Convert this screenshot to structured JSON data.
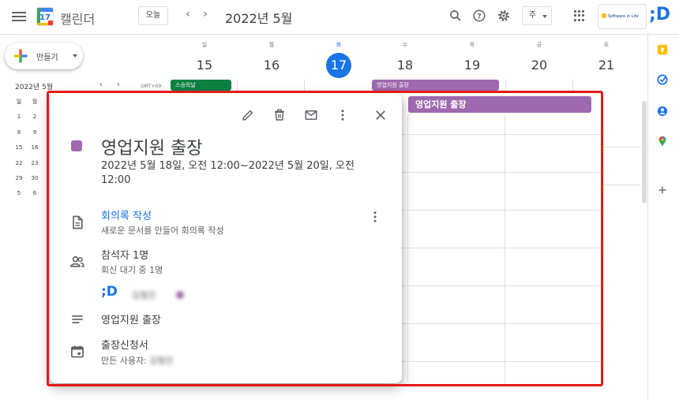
{
  "topbar": {
    "app_title": "캘린더",
    "logo_number": "17",
    "today_label": "오늘",
    "prev": "‹",
    "next": "›",
    "month_title": "2022년 5월",
    "view_label": "주",
    "brand_text": "Software in Life",
    "brand_mark": ";D"
  },
  "sidebar": {
    "create_label": "만들기",
    "mini_title": "2022년 5월",
    "mini_prev": "‹",
    "mini_next": "›",
    "gmt": "GMT+09",
    "mini_days_header": [
      "일",
      "월"
    ],
    "mini_rows": [
      [
        "1",
        "2"
      ],
      [
        "8",
        "9"
      ],
      [
        "15",
        "16"
      ],
      [
        "22",
        "23"
      ],
      [
        "29",
        "30"
      ],
      [
        "5",
        "6"
      ]
    ]
  },
  "week": {
    "days": [
      {
        "dow": "일",
        "num": "15"
      },
      {
        "dow": "월",
        "num": "16"
      },
      {
        "dow": "화",
        "num": "17"
      },
      {
        "dow": "수",
        "num": "18"
      },
      {
        "dow": "목",
        "num": "19"
      },
      {
        "dow": "금",
        "num": "20"
      },
      {
        "dow": "토",
        "num": "21"
      }
    ],
    "allday_green": "스승의날",
    "allday_purple": "영업지원 출장",
    "event_bar": "영업지원 출장"
  },
  "popup": {
    "title": "영업지원 출장",
    "time": "2022년 5월 18일, 오전 12:00~2022년 5월 20일, 오전 12:00",
    "notes_link": "회의록 작성",
    "notes_sub": "새로운 문서를 만들어 회의록 작성",
    "guests_title": "참석자 1명",
    "guests_sub": "회신 대기 중 1명",
    "guest_logo": ";D",
    "guest_name": "김형진",
    "description": "영업지원 출장",
    "attachment_title": "출장신청서",
    "creator_prefix": "만든 사용자: ",
    "creator_name": "김형진"
  },
  "colors": {
    "event_purple": "#9e69af",
    "holiday_green": "#0b8043",
    "today_blue": "#1a73e8",
    "highlight_red": "#e31b1b"
  }
}
